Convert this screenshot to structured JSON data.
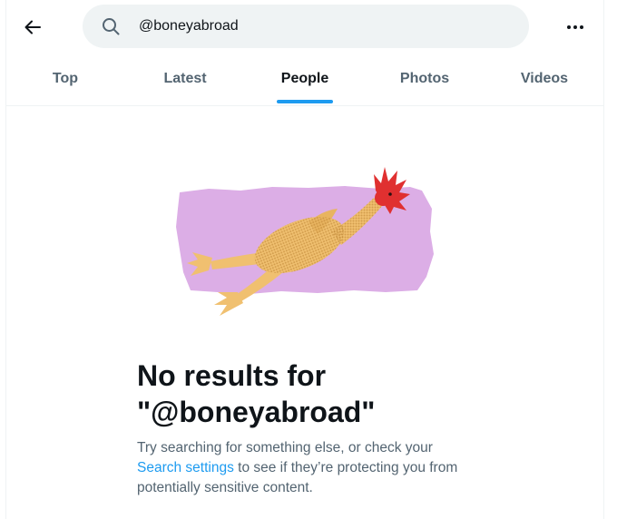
{
  "search": {
    "value": "@boneyabroad",
    "placeholder": "Search"
  },
  "tabs": [
    {
      "label": "Top",
      "active": false
    },
    {
      "label": "Latest",
      "active": false
    },
    {
      "label": "People",
      "active": true
    },
    {
      "label": "Photos",
      "active": false
    },
    {
      "label": "Videos",
      "active": false
    }
  ],
  "empty_state": {
    "title_line1": "No results for",
    "title_line2": "\"@boneyabroad\"",
    "desc_before_link": "Try searching for something else, or check your ",
    "link_label": "Search settings",
    "desc_after_link": " to see if they’re protecting you from potentially sensitive content."
  },
  "colors": {
    "accent": "#1d9bf0",
    "text_primary": "#0f1419",
    "text_secondary": "#536471",
    "search_bg": "#eff3f4",
    "illustration_bg": "#dcaee6",
    "chicken_body": "#f0c070",
    "chicken_comb": "#e03030"
  },
  "icons": {
    "back": "arrow-left-icon",
    "search": "search-icon",
    "more": "more-horizontal-icon",
    "illustration": "rubber-chicken-illustration"
  }
}
